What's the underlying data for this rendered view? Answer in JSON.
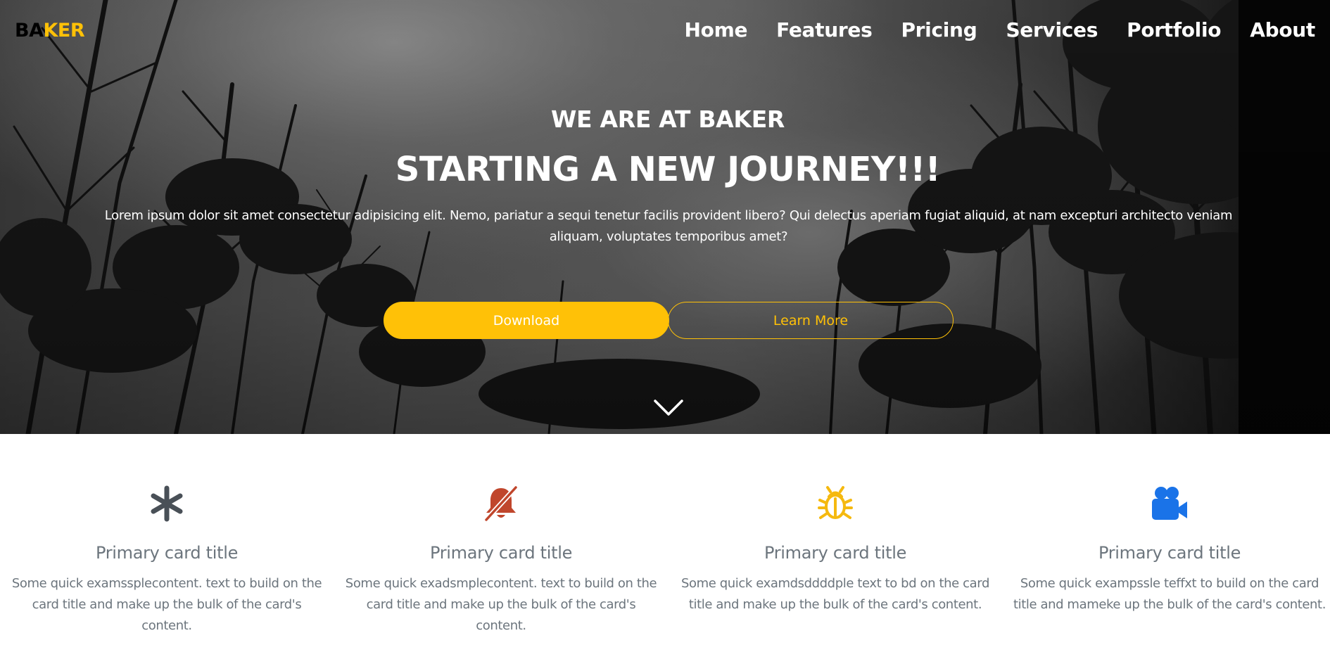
{
  "brand": {
    "part1": "BA",
    "part2": "KER",
    "accent_color": "#ffc107"
  },
  "nav": {
    "items": [
      {
        "label": "Home"
      },
      {
        "label": "Features"
      },
      {
        "label": "Pricing"
      },
      {
        "label": "Services"
      },
      {
        "label": "Portfolio"
      },
      {
        "label": "About"
      }
    ]
  },
  "hero": {
    "subtitle": "WE ARE AT BAKER",
    "title": "STARTING A NEW JOURNEY!!!",
    "text": "Lorem ipsum dolor sit amet consectetur adipisicing elit. Nemo, pariatur a sequi tenetur facilis provident libero? Qui delectus aperiam fugiat aliquid, at nam excepturi architecto veniam aliquam, voluptates temporibus amet?",
    "download_label": "Download",
    "learn_more_label": "Learn More",
    "scroll_icon": "chevron-down-icon"
  },
  "features": {
    "cards": [
      {
        "icon": "asterisk-icon",
        "icon_color": "#495057",
        "title": "Primary card title",
        "text": "Some quick examssplecontent. text to build on the card title and make up the bulk of the card's content."
      },
      {
        "icon": "bell-slash-icon",
        "icon_color": "#c0462c",
        "title": "Primary card title",
        "text": "Some quick exadsmplecontent. text to build on the card title and make up the bulk of the card's content."
      },
      {
        "icon": "bug-icon",
        "icon_color": "#f5b90f",
        "title": "Primary card title",
        "text": "Some quick examdsddddple text to bd on the card title and make up the bulk of the card's content."
      },
      {
        "icon": "video-camera-icon",
        "icon_color": "#1a73e8",
        "title": "Primary card title",
        "text": "Some quick exampssle teffxt to build on the card title and mameke up the bulk of the card's content."
      }
    ]
  }
}
